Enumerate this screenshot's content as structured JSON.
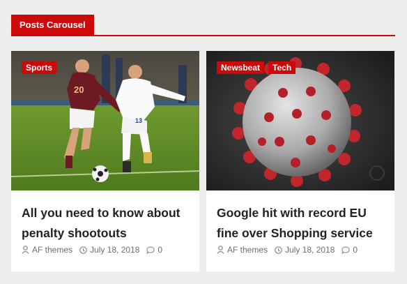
{
  "section": {
    "title": "Posts Carousel"
  },
  "posts": [
    {
      "tags": [
        "Sports"
      ],
      "title": "All you need to know about penalty shootouts",
      "author": "AF themes",
      "date": "July 18, 2018",
      "comments": "0",
      "image_icon": "soccer-players-photo"
    },
    {
      "tags": [
        "Newsbeat",
        "Tech"
      ],
      "title": "Google hit with record EU fine over Shopping service",
      "author": "AF themes",
      "date": "July 18, 2018",
      "comments": "0",
      "image_icon": "coronavirus-render-photo"
    }
  ],
  "colors": {
    "accent": "#cc0a0a",
    "background": "#eeeeee",
    "card": "#ffffff",
    "meta_text": "#6d6d6d"
  }
}
